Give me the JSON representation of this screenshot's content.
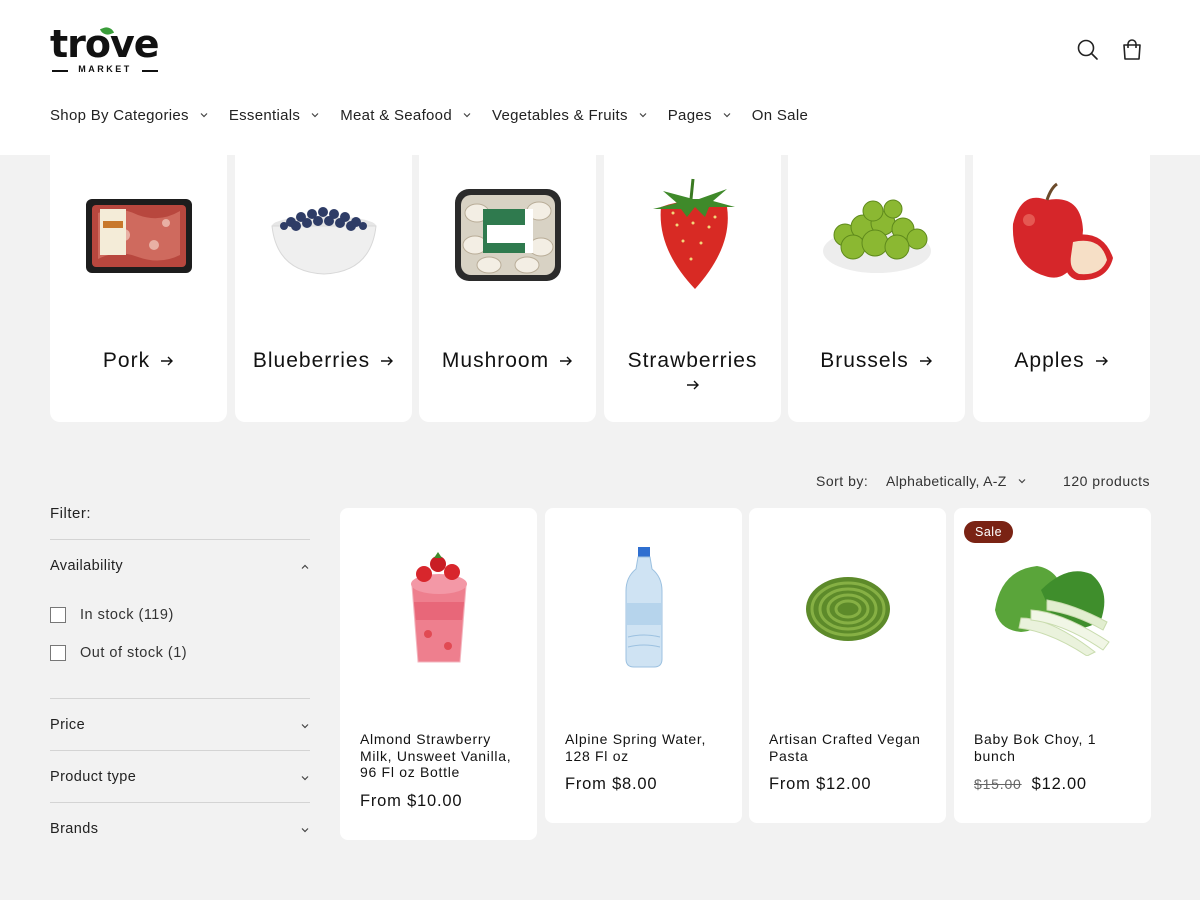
{
  "brand": {
    "name": "trove",
    "tagline": "MARKET"
  },
  "header": {
    "search_icon": "search-icon",
    "cart_icon": "cart-icon"
  },
  "nav": [
    {
      "label": "Shop By Categories",
      "has_dropdown": true
    },
    {
      "label": "Essentials",
      "has_dropdown": true
    },
    {
      "label": "Meat & Seafood",
      "has_dropdown": true
    },
    {
      "label": "Vegetables & Fruits",
      "has_dropdown": true
    },
    {
      "label": "Pages",
      "has_dropdown": true
    },
    {
      "label": "On Sale",
      "has_dropdown": false
    }
  ],
  "categories": [
    {
      "label": "Pork",
      "image": "pork-package"
    },
    {
      "label": "Blueberries",
      "image": "blueberry-bowl"
    },
    {
      "label": "Mushroom",
      "image": "mushroom-package"
    },
    {
      "label": "Strawberries",
      "image": "strawberry"
    },
    {
      "label": "Brussels",
      "image": "brussels-bowl"
    },
    {
      "label": "Apples",
      "image": "apple"
    }
  ],
  "toolbar": {
    "sort_label": "Sort by:",
    "sort_value": "Alphabetically, A-Z",
    "product_count": "120 products"
  },
  "filter": {
    "title": "Filter:",
    "availability": {
      "label": "Availability",
      "expanded": true,
      "options": [
        {
          "label": "In stock (119)",
          "checked": false
        },
        {
          "label": "Out of stock (1)",
          "checked": false
        }
      ]
    },
    "price": {
      "label": "Price"
    },
    "product_type": {
      "label": "Product type"
    },
    "brands": {
      "label": "Brands"
    }
  },
  "products": [
    {
      "title": "Almond Strawberry Milk, Unsweet Vanilla, 96 Fl oz Bottle",
      "price": "From $10.00",
      "image": "strawberry-smoothie"
    },
    {
      "title": "Alpine Spring Water, 128 Fl oz",
      "price": "From $8.00",
      "image": "water-bottle"
    },
    {
      "title": "Artisan Crafted Vegan Pasta",
      "price": "From $12.00",
      "image": "green-pasta"
    },
    {
      "title": "Baby Bok Choy, 1 bunch",
      "compare_price": "$15.00",
      "price": "$12.00",
      "badge": "Sale",
      "image": "bok-choy"
    }
  ],
  "colors": {
    "sale_badge": "#7a2314",
    "background": "#f2f2f2",
    "card": "#ffffff"
  }
}
